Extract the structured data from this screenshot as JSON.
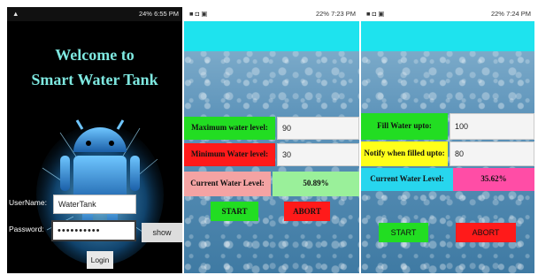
{
  "screen1": {
    "status_left": "▲",
    "status_right": "24% 6:55 PM",
    "title_line1": "Welcome to",
    "title_line2": "Smart Water Tank",
    "username_label": "UserName:",
    "username_value": "WaterTank",
    "password_label": "Password:",
    "password_value": "••••••••••",
    "show_button": "show",
    "login_button": "Login"
  },
  "screen2": {
    "status_right": "22% 7:23 PM",
    "max_label": "Maximum water level:",
    "max_value": "90",
    "min_label": "Minimum Water level:",
    "min_value": "30",
    "current_label": "Current Water Level:",
    "current_value": "50.89%",
    "start_button": "START",
    "abort_button": "ABORT"
  },
  "screen3": {
    "status_right": "22% 7:24 PM",
    "fill_label": "Fill Water upto:",
    "fill_value": "100",
    "notify_label": "Notify when filled upto:",
    "notify_value": "80",
    "current_label": "Current Water Level:",
    "current_value": "35.62%",
    "start_button": "START",
    "abort_button": "ABORT"
  },
  "colors": {
    "cyan": "#1ee3ee",
    "green": "#22dd22",
    "red": "#ff1a1a",
    "yellow": "#ffff1a",
    "pink": "#f4a3a3",
    "light_green": "#9af09a",
    "current_blue": "#27d6ee"
  }
}
